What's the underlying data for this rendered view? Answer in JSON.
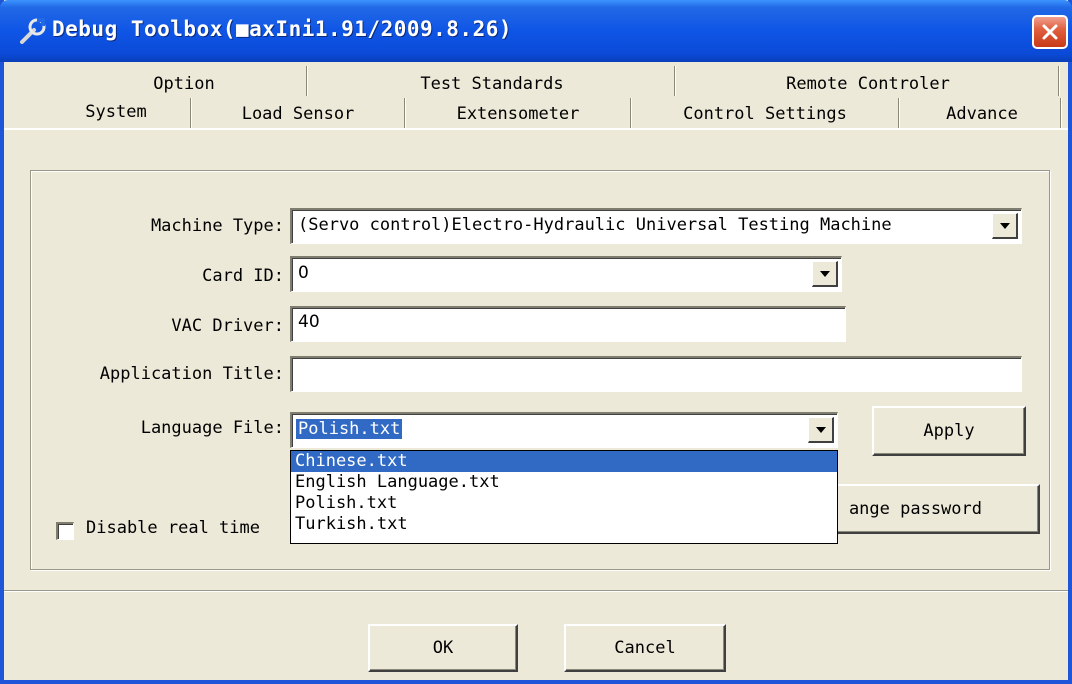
{
  "window": {
    "title": "Debug Toolbox(■axIni1.91/2009.8.26)"
  },
  "tabs": {
    "row1": [
      {
        "label": "Option"
      },
      {
        "label": "Test Standards"
      },
      {
        "label": "Remote Controler"
      }
    ],
    "row2": [
      {
        "label": "System",
        "selected": true
      },
      {
        "label": "Load Sensor"
      },
      {
        "label": "Extensometer"
      },
      {
        "label": "Control Settings"
      },
      {
        "label": "Advance"
      }
    ]
  },
  "form": {
    "machine_type": {
      "label": "Machine Type:",
      "value": "(Servo control)Electro-Hydraulic Universal Testing Machine"
    },
    "card_id": {
      "label": "Card ID:",
      "value": "0"
    },
    "vac_driver": {
      "label": "VAC Driver:",
      "value": "40"
    },
    "application_title": {
      "label": "Application Title:",
      "value": ""
    },
    "language_file": {
      "label": "Language File:",
      "value": "Polish.txt",
      "options": [
        "Chinese.txt",
        "English Language.txt",
        "Polish.txt",
        "Turkish.txt"
      ],
      "highlighted_option": "Chinese.txt"
    },
    "apply_label": "Apply",
    "change_password_label": "ange password",
    "disable_realtime_label": "Disable real time",
    "disable_realtime_checked": false
  },
  "footer": {
    "ok_label": "OK",
    "cancel_label": "Cancel"
  },
  "colors": {
    "titlebar": "#0b4ad6",
    "face": "#ece9d8",
    "selection": "#316ac5",
    "close": "#e0603f"
  }
}
